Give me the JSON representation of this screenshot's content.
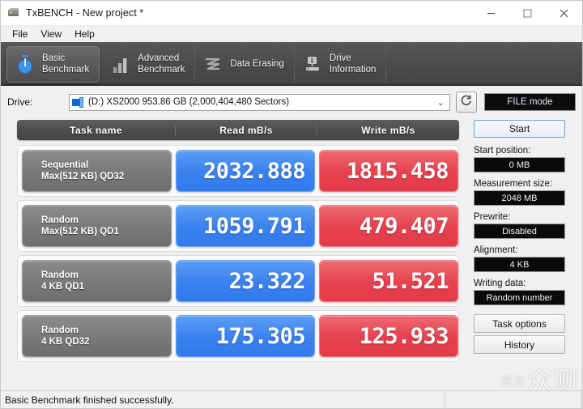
{
  "window": {
    "title": "TxBENCH - New project *",
    "icon": "drive-icon",
    "controls": {
      "minimize": "–",
      "maximize": "□",
      "close": "✕"
    }
  },
  "menu": {
    "items": [
      "File",
      "View",
      "Help"
    ]
  },
  "tabs": [
    {
      "label": "Basic\nBenchmark",
      "icon": "stopwatch-icon",
      "active": true
    },
    {
      "label": "Advanced\nBenchmark",
      "icon": "bar-chart-icon",
      "active": false
    },
    {
      "label": "Data Erasing",
      "icon": "erase-icon",
      "active": false
    },
    {
      "label": "Drive\nInformation",
      "icon": "drive-info-icon",
      "active": false
    }
  ],
  "drive_bar": {
    "label": "Drive:",
    "value": "(D:) XS2000  953.86 GB (2,000,404,480 Sectors)",
    "caret": "⌄",
    "refresh_icon": "refresh-icon",
    "mode_button": "FILE mode"
  },
  "results": {
    "headers": [
      "Task name",
      "Read mB/s",
      "Write mB/s"
    ],
    "rows": [
      {
        "task_line1": "Sequential",
        "task_line2": "Max(512 KB) QD32",
        "read": "2032.888",
        "write": "1815.458"
      },
      {
        "task_line1": "Random",
        "task_line2": "Max(512 KB) QD1",
        "read": "1059.791",
        "write": "479.407"
      },
      {
        "task_line1": "Random",
        "task_line2": "4 KB QD1",
        "read": "23.322",
        "write": "51.521"
      },
      {
        "task_line1": "Random",
        "task_line2": "4 KB QD32",
        "read": "175.305",
        "write": "125.933"
      }
    ]
  },
  "side_panel": {
    "start_button": "Start",
    "fields": [
      {
        "label": "Start position:",
        "value": "0 MB"
      },
      {
        "label": "Measurement size:",
        "value": "2048 MB"
      },
      {
        "label": "Prewrite:",
        "value": "Disabled"
      },
      {
        "label": "Alignment:",
        "value": "4 KB"
      },
      {
        "label": "Writing data:",
        "value": "Random number"
      }
    ],
    "task_options_button": "Task options",
    "history_button": "History"
  },
  "statusbar": {
    "message": "Basic Benchmark finished successfully."
  },
  "watermark": {
    "small": "新浪",
    "large": "众测"
  },
  "colors": {
    "read_blue": "#3a81ef",
    "write_red": "#e5414e",
    "tab_strip": "#4b4b4b",
    "window_bg": "#f0f0f0",
    "field_bg": "#0a0a0a"
  }
}
